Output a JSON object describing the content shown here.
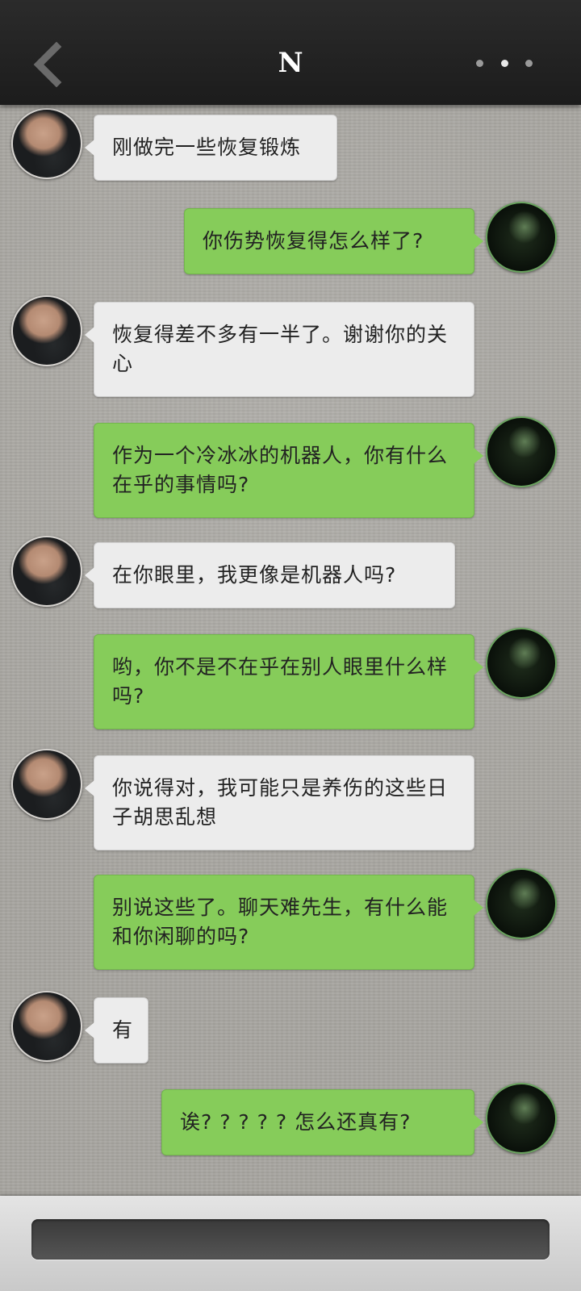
{
  "header": {
    "title": "N",
    "back_icon": "chevron-left-icon",
    "more_icon": "more-dots-icon"
  },
  "messages": [
    {
      "side": "left",
      "text": "刚做完一些恢复锻炼"
    },
    {
      "side": "right",
      "text": "你伤势恢复得怎么样了?"
    },
    {
      "side": "left",
      "text": "恢复得差不多有一半了。谢谢你的关心"
    },
    {
      "side": "right",
      "text": "作为一个冷冰冰的机器人，你有什么在乎的事情吗?"
    },
    {
      "side": "left",
      "text": "在你眼里，我更像是机器人吗?"
    },
    {
      "side": "right",
      "text": "哟，你不是不在乎在别人眼里什么样吗?"
    },
    {
      "side": "left",
      "text": "你说得对，我可能只是养伤的这些日子胡思乱想"
    },
    {
      "side": "right",
      "text": "别说这些了。聊天难先生，有什么能和你闲聊的吗?"
    },
    {
      "side": "left",
      "text": "有"
    },
    {
      "side": "right",
      "text": "诶? ? ? ? ? 怎么还真有?"
    }
  ],
  "input": {
    "value": "",
    "placeholder": ""
  },
  "colors": {
    "outgoing_bubble": "#86cc5a",
    "incoming_bubble": "#ececec",
    "header_bg": "#222222"
  }
}
